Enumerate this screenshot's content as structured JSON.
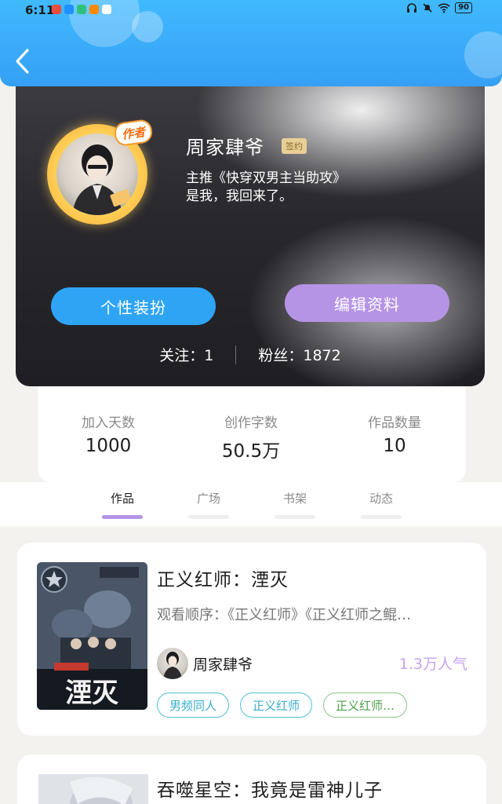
{
  "status_bar": {
    "time": "6:11",
    "battery": "90"
  },
  "header": {
    "back_icon": "chevron-left-icon"
  },
  "profile": {
    "author_tag": "作者",
    "name": "周家肆爷",
    "sign_badge": "签约",
    "bio_line1": "主推《快穿双男主当助攻》",
    "bio_line2": "是我，我回来了。",
    "dress_button": "个性装扮",
    "edit_button": "编辑资料",
    "following": "关注：1",
    "fans": "粉丝：1872"
  },
  "stats": [
    {
      "label": "加入天数",
      "value": "1000"
    },
    {
      "label": "创作字数",
      "value": "50.5万"
    },
    {
      "label": "作品数量",
      "value": "10"
    }
  ],
  "tabs": [
    {
      "label": "作品",
      "active": true
    },
    {
      "label": "广场",
      "active": false
    },
    {
      "label": "书架",
      "active": false
    },
    {
      "label": "动态",
      "active": false
    }
  ],
  "works": [
    {
      "title": "正义红师：湮灭",
      "order": "观看顺序：《正义红师》《正义红师之鲲…",
      "author": "周家肆爷",
      "popularity": "1.3万人气",
      "cover_text": "湮灭",
      "tags": [
        "男频同人",
        "正义红师",
        "正义红师…"
      ]
    },
    {
      "title": "吞噬星空：我竟是雷神儿子"
    }
  ],
  "colors": {
    "header_blue": "#3aaaf8",
    "accent_purple": "#b594e6",
    "button_blue": "#2fa4f5",
    "popularity": "#c7a3ea"
  }
}
